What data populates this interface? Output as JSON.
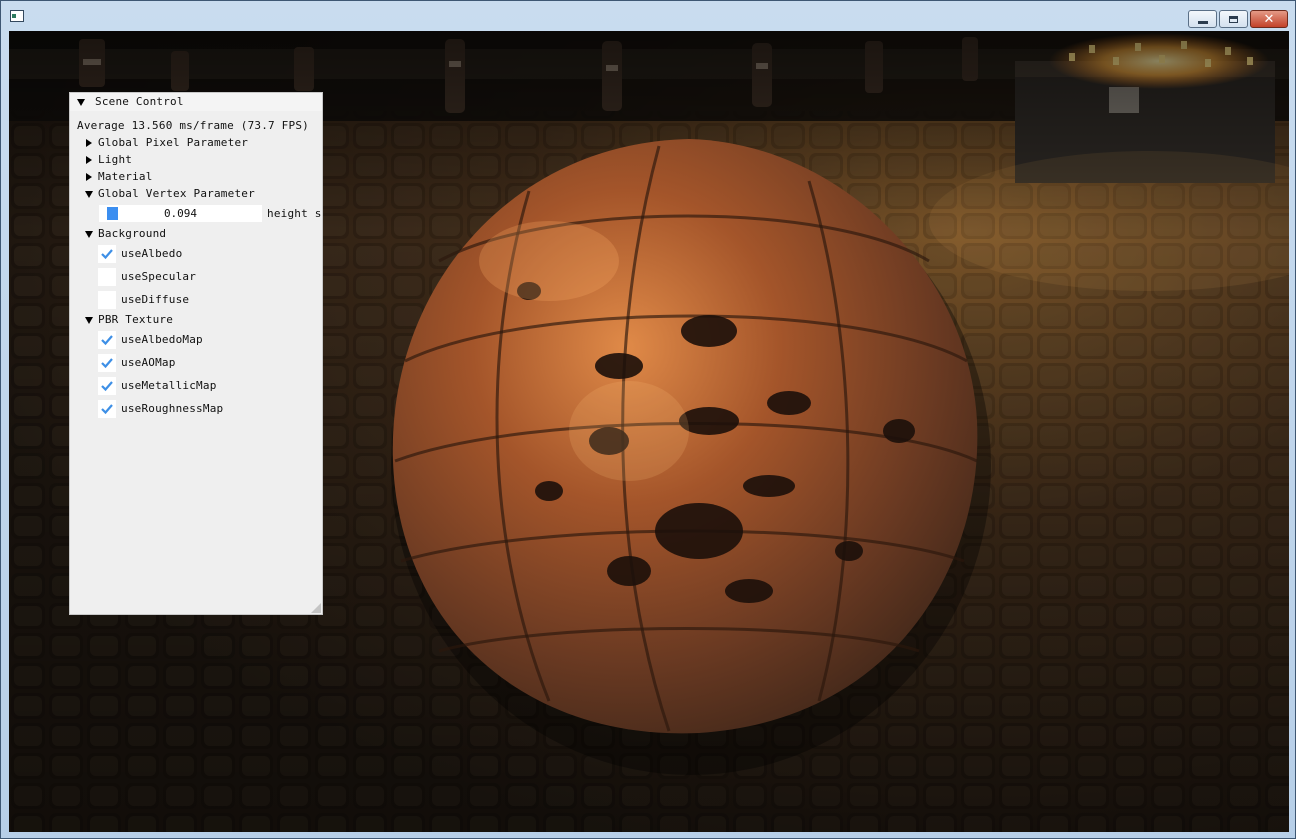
{
  "window": {
    "controls": {
      "minimize": "minimize",
      "maximize": "maximize",
      "close": "close"
    },
    "close_glyph": "✕"
  },
  "panel": {
    "title": "Scene Control",
    "stats": "Average 13.560 ms/frame (73.7 FPS)",
    "sections": {
      "global_pixel": "Global Pixel Parameter",
      "light": "Light",
      "material": "Material",
      "global_vertex": "Global Vertex Parameter",
      "background": "Background",
      "pbr_texture": "PBR Texture"
    },
    "height_slider": {
      "value": "0.094",
      "label": "height s",
      "fraction": 0.094
    },
    "background": {
      "use_albedo": {
        "label": "useAlbedo",
        "checked": true
      },
      "use_specular": {
        "label": "useSpecular",
        "checked": false
      },
      "use_diffuse": {
        "label": "useDiffuse",
        "checked": false
      }
    },
    "pbr": {
      "use_albedo_map": {
        "label": "useAlbedoMap",
        "checked": true
      },
      "use_ao_map": {
        "label": "useAOMap",
        "checked": true
      },
      "use_metallic_map": {
        "label": "useMetallicMap",
        "checked": true
      },
      "use_roughness_map": {
        "label": "useRoughnessMap",
        "checked": true
      }
    }
  },
  "colors": {
    "check_mark": "#3d8fe6",
    "slider_grab": "#3b8ef0",
    "panel_bg": "#efefef",
    "sphere_copper": "#b8622c"
  }
}
